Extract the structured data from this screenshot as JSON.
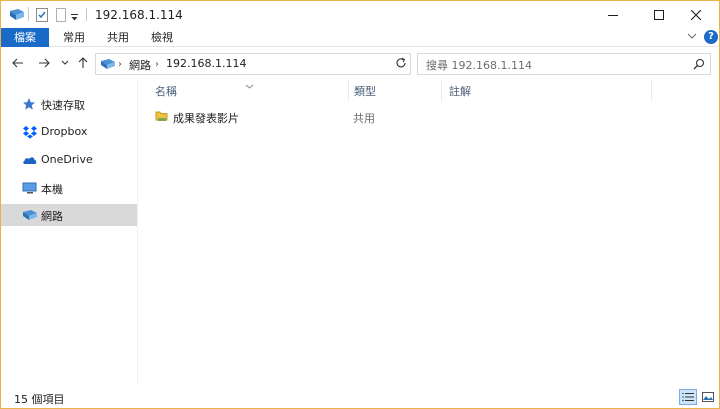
{
  "titlebar": {
    "title": "192.168.1.114",
    "icons": [
      "network-folder-icon",
      "properties-icon",
      "new-folder-icon",
      "quick-access-dropdown-icon"
    ],
    "controls": [
      "minimize-icon",
      "maximize-icon",
      "close-icon"
    ]
  },
  "ribbon": {
    "tabs": [
      "檔案",
      "常用",
      "共用",
      "檢視"
    ],
    "accent": "#1a6ac7",
    "help": "?"
  },
  "address": {
    "crumbs": [
      "網路",
      "192.168.1.114"
    ]
  },
  "search": {
    "placeholder": "搜尋 192.168.1.114"
  },
  "sidebar": {
    "items": [
      {
        "label": "快速存取",
        "icon": "star-icon"
      },
      {
        "label": "Dropbox",
        "icon": "dropbox-icon"
      },
      {
        "label": "OneDrive",
        "icon": "onedrive-icon"
      },
      {
        "label": "本機",
        "icon": "computer-icon"
      },
      {
        "label": "網路",
        "icon": "network-icon",
        "selected": true
      }
    ]
  },
  "columns": [
    "名稱",
    "類型",
    "註解"
  ],
  "rows": [
    {
      "name": "成果發表影片",
      "type": "共用",
      "icon": "shared-folder-icon"
    }
  ],
  "status": {
    "item_count": "15 個項目"
  }
}
